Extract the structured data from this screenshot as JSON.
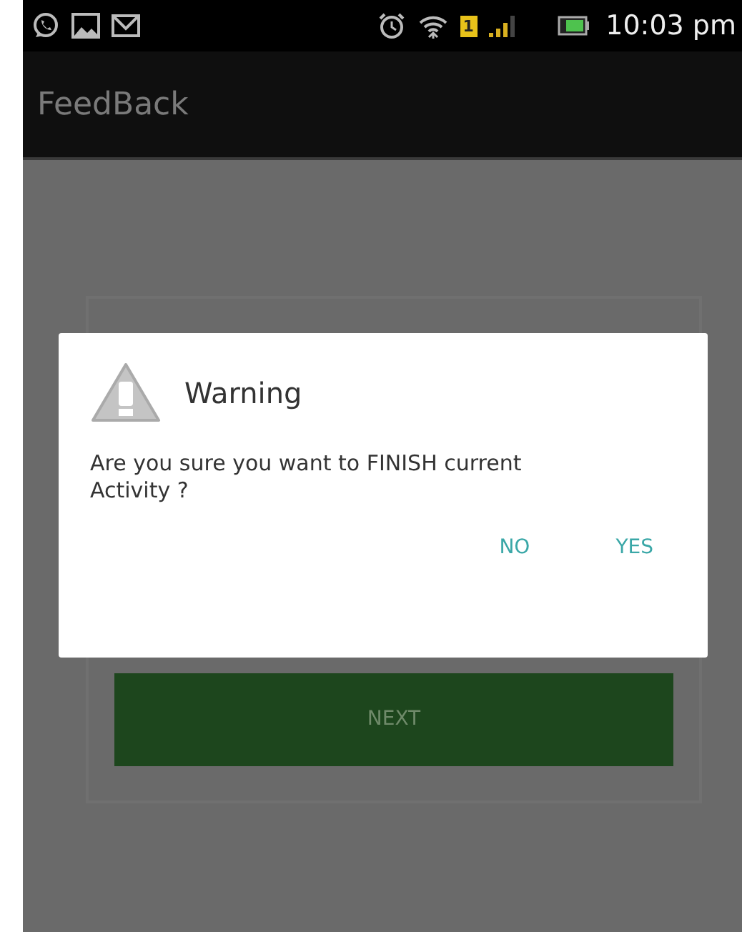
{
  "status_bar": {
    "sim_slot": "1",
    "time": "10:03 pm"
  },
  "action_bar": {
    "title": "FeedBack"
  },
  "form": {
    "button": "NEXT"
  },
  "dialog": {
    "title": "Warning",
    "message": "Are you sure you want to FINISH current Activity ?",
    "buttons": [
      "NO",
      "YES"
    ]
  }
}
